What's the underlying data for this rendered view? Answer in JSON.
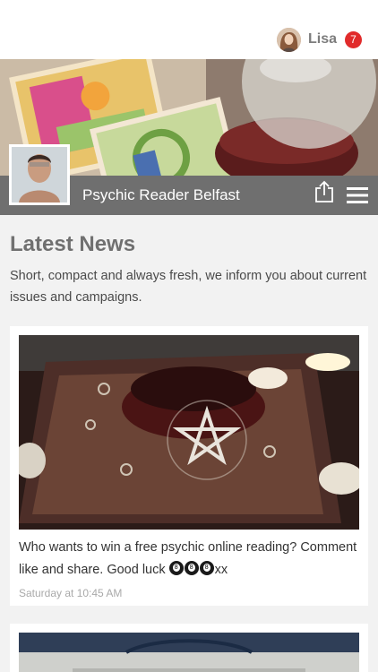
{
  "user": {
    "name": "Lisa",
    "notifications": "7",
    "avatar_icon": "user-avatar"
  },
  "header": {
    "page_name": "Psychic Reader Belfast",
    "share_icon": "share-icon",
    "menu_icon": "hamburger-menu-icon"
  },
  "news": {
    "title": "Latest News",
    "description": "Short, compact and always fresh, we inform you about current issues and campaigns.",
    "posts": [
      {
        "text": "Who wants to win a free psychic online reading? Comment like and share. Good luck",
        "emoji_suffix": "xx",
        "emoji_name": "8-ball",
        "emoji_count": 3,
        "time": "Saturday at 10:45 AM"
      }
    ]
  },
  "colors": {
    "badge": "#e12b2b",
    "titlebar": "#6f6f6f",
    "background": "#f2f2f2"
  }
}
